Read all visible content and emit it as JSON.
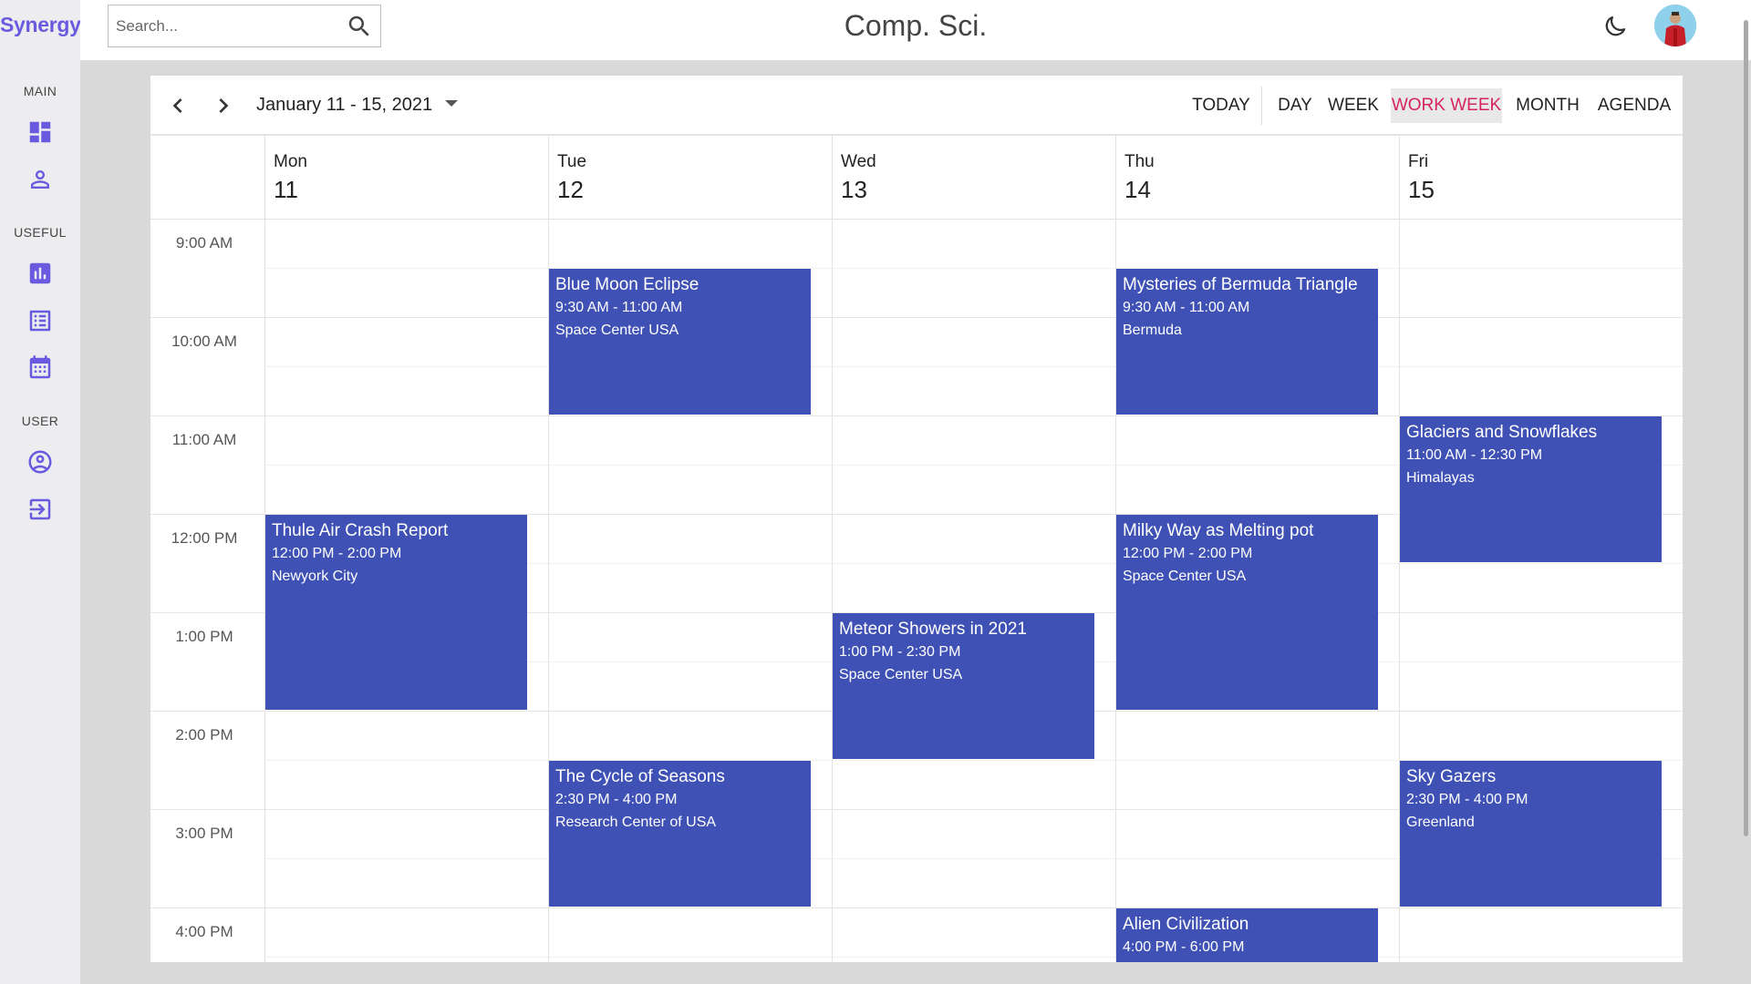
{
  "app": {
    "name": "Synergy",
    "title": "Comp. Sci."
  },
  "search": {
    "placeholder": "Search..."
  },
  "sidebar": {
    "sections": [
      {
        "label": "MAIN",
        "items": [
          {
            "icon": "dashboard-icon"
          },
          {
            "icon": "person-icon"
          }
        ]
      },
      {
        "label": "USEFUL",
        "items": [
          {
            "icon": "bar-chart-icon"
          },
          {
            "icon": "list-icon"
          },
          {
            "icon": "calendar-icon"
          }
        ]
      },
      {
        "label": "USER",
        "items": [
          {
            "icon": "account-circle-icon"
          },
          {
            "icon": "logout-icon"
          }
        ]
      }
    ]
  },
  "header": {
    "theme_icon": "moon-icon",
    "avatar_icon": "user-avatar"
  },
  "calendar": {
    "date_range": "January 11 - 15, 2021",
    "buttons": {
      "today": "TODAY",
      "day": "DAY",
      "week": "WEEK",
      "work_week": "WORK WEEK",
      "month": "MONTH",
      "agenda": "AGENDA"
    },
    "active_view": "WORK WEEK",
    "days": [
      {
        "name": "Mon",
        "date": "11"
      },
      {
        "name": "Tue",
        "date": "12"
      },
      {
        "name": "Wed",
        "date": "13"
      },
      {
        "name": "Thu",
        "date": "14"
      },
      {
        "name": "Fri",
        "date": "15"
      }
    ],
    "time_labels": [
      "9:00 AM",
      "10:00 AM",
      "11:00 AM",
      "12:00 PM",
      "1:00 PM",
      "2:00 PM",
      "3:00 PM",
      "4:00 PM"
    ],
    "events": [
      {
        "title": "Blue Moon Eclipse",
        "time": "9:30 AM - 11:00 AM",
        "location": "Space Center USA"
      },
      {
        "title": "Mysteries of Bermuda Triangle",
        "time": "9:30 AM - 11:00 AM",
        "location": "Bermuda"
      },
      {
        "title": "Glaciers and Snowflakes",
        "time": "11:00 AM - 12:30 PM",
        "location": "Himalayas"
      },
      {
        "title": "Thule Air Crash Report",
        "time": "12:00 PM - 2:00 PM",
        "location": "Newyork City"
      },
      {
        "title": "Milky Way as Melting pot",
        "time": "12:00 PM - 2:00 PM",
        "location": "Space Center USA"
      },
      {
        "title": "Meteor Showers in 2021",
        "time": "1:00 PM - 2:30 PM",
        "location": "Space Center USA"
      },
      {
        "title": "The Cycle of Seasons",
        "time": "2:30 PM - 4:00 PM",
        "location": "Research Center of USA"
      },
      {
        "title": "Sky Gazers",
        "time": "2:30 PM - 4:00 PM",
        "location": "Greenland"
      },
      {
        "title": "Alien Civilization",
        "time": "4:00 PM - 6:00 PM",
        "location": ""
      }
    ],
    "colors": {
      "event": "#3f51b5",
      "active_view": "#d6245d",
      "brand": "#6a5ae0"
    }
  }
}
